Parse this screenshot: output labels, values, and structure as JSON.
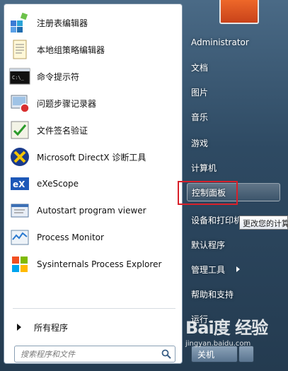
{
  "programs": [
    {
      "label": "注册表编辑器",
      "icon": "registry-editor-icon"
    },
    {
      "label": "本地组策略编辑器",
      "icon": "group-policy-icon"
    },
    {
      "label": "命令提示符",
      "icon": "command-prompt-icon"
    },
    {
      "label": "问题步骤记录器",
      "icon": "steps-recorder-icon"
    },
    {
      "label": "文件签名验证",
      "icon": "file-signature-icon"
    },
    {
      "label": "Microsoft DirectX 诊断工具",
      "icon": "directx-icon"
    },
    {
      "label": "eXeScope",
      "icon": "exescope-icon"
    },
    {
      "label": "Autostart program viewer",
      "icon": "autostart-viewer-icon"
    },
    {
      "label": "Process Monitor",
      "icon": "process-monitor-icon"
    },
    {
      "label": "Sysinternals Process Explorer",
      "icon": "process-explorer-icon"
    }
  ],
  "all_programs_label": "所有程序",
  "search": {
    "placeholder": "搜索程序和文件"
  },
  "right_items": [
    {
      "label": "Administrator"
    },
    {
      "label": "文档"
    },
    {
      "label": "图片"
    },
    {
      "label": "音乐"
    },
    {
      "label": "游戏"
    },
    {
      "label": "计算机"
    },
    {
      "label": "控制面板"
    },
    {
      "label": "设备和打印机"
    },
    {
      "label": "默认程序"
    },
    {
      "label": "管理工具"
    },
    {
      "label": "帮助和支持"
    },
    {
      "label": "运行..."
    }
  ],
  "tooltip": "更改您的计算",
  "shutdown_label": "关机",
  "watermark": {
    "logo": "Bai度 经验",
    "url": "jingyan.baidu.com"
  },
  "colors": {
    "highlight_box": "#d9202a",
    "menu_bg": "#2e4a63"
  }
}
